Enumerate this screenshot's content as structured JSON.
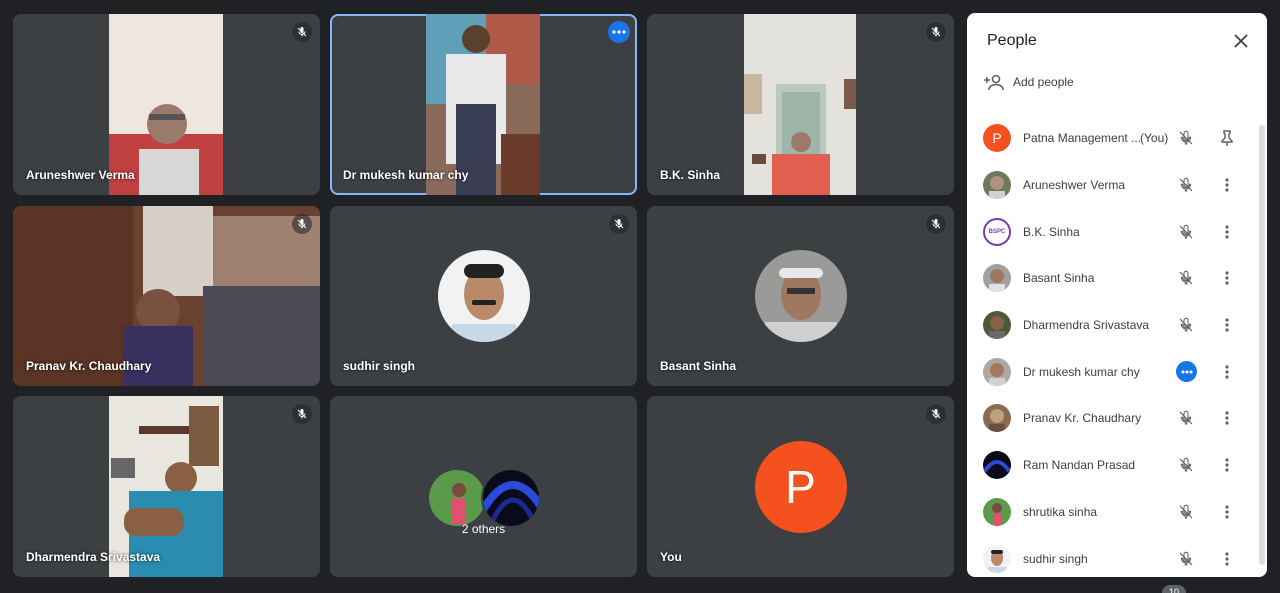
{
  "tiles": [
    {
      "name": "Aruneshwer Verma"
    },
    {
      "name": "Dr mukesh kumar chy"
    },
    {
      "name": "B.K. Sinha"
    },
    {
      "name": "Pranav Kr. Chaudhary"
    },
    {
      "name": "sudhir singh"
    },
    {
      "name": "Basant Sinha"
    },
    {
      "name": "Dharmendra Srivastava"
    },
    {
      "name": "2 others"
    },
    {
      "name": "You",
      "letter": "P"
    }
  ],
  "panel": {
    "title": "People",
    "add_people": "Add people",
    "participants": [
      {
        "name": "Patna Management ...",
        "suffix": "(You)",
        "letter": "P"
      },
      {
        "name": "Aruneshwer Verma"
      },
      {
        "name": "B.K. Sinha",
        "badge": "BSPC"
      },
      {
        "name": "Basant Sinha"
      },
      {
        "name": "Dharmendra Srivastava"
      },
      {
        "name": "Dr mukesh kumar chy"
      },
      {
        "name": "Pranav Kr. Chaudhary"
      },
      {
        "name": "Ram Nandan Prasad"
      },
      {
        "name": "shrutika sinha"
      },
      {
        "name": "sudhir singh"
      }
    ]
  },
  "footer": {
    "badge": "10"
  },
  "colors": {
    "background": "#202124",
    "tile": "#3c4043",
    "accent": "#1a73e8",
    "active_outline": "#8ab4f8",
    "you_avatar": "#f4511e"
  }
}
